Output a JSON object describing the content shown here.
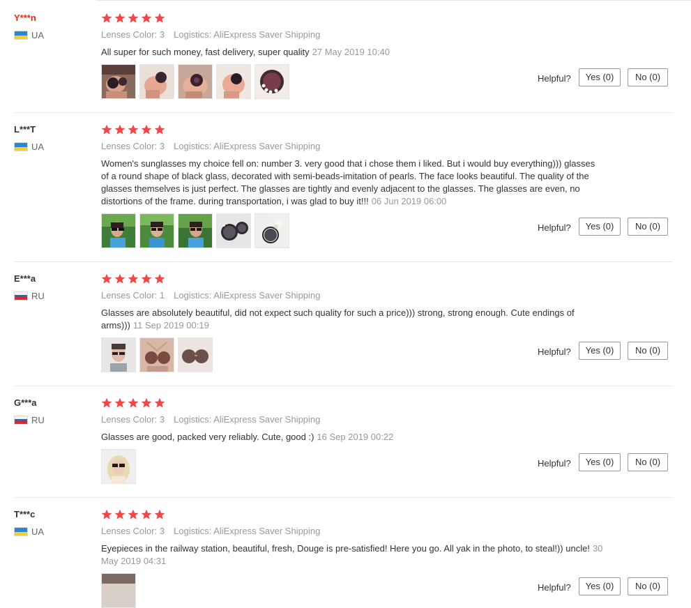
{
  "helpful_label": "Helpful?",
  "star_color": "#f04848",
  "reviews": [
    {
      "name": "Y***n",
      "name_highlight": true,
      "country": "UA",
      "flag": "ua",
      "stars": 5,
      "lenses_label": "Lenses Color:",
      "lenses_value": "3",
      "logistics_label": "Logistics:",
      "logistics_value": "AliExpress Saver Shipping",
      "text": "All super for such money, fast delivery, super quality",
      "date": "27 May 2019 10:40",
      "photos": 5,
      "yes": "Yes (0)",
      "no": "No (0)"
    },
    {
      "name": "L***T",
      "name_highlight": false,
      "country": "UA",
      "flag": "ua",
      "stars": 5,
      "lenses_label": "Lenses Color:",
      "lenses_value": "3",
      "logistics_label": "Logistics:",
      "logistics_value": "AliExpress Saver Shipping",
      "text": "Women's sunglasses my choice fell on: number 3. very good that i chose them i liked. But i would buy everything))) glasses of a round shape of black glass, decorated with semi-beads-imitation of pearls. The face looks beautiful. The quality of the glasses themselves is just perfect. The glasses are tightly and evenly adjacent to the glasses. The glasses are even, no distortions of the frame. during transportation, i was glad to buy it!!!",
      "date": "06 Jun 2019 06:00",
      "photos": 5,
      "yes": "Yes (0)",
      "no": "No (0)"
    },
    {
      "name": "E***a",
      "name_highlight": false,
      "country": "RU",
      "flag": "ru",
      "stars": 5,
      "lenses_label": "Lenses Color:",
      "lenses_value": "1",
      "logistics_label": "Logistics:",
      "logistics_value": "AliExpress Saver Shipping",
      "text": "Glasses are absolutely beautiful, did not expect such quality for such a price))) strong, strong enough. Cute endings of arms)))",
      "date": "11 Sep 2019 00:19",
      "photos": 3,
      "yes": "Yes (0)",
      "no": "No (0)"
    },
    {
      "name": "G***a",
      "name_highlight": false,
      "country": "RU",
      "flag": "ru",
      "stars": 5,
      "lenses_label": "Lenses Color:",
      "lenses_value": "3",
      "logistics_label": "Logistics:",
      "logistics_value": "AliExpress Saver Shipping",
      "text": "Glasses are good, packed very reliably. Cute, good :)",
      "date": "16 Sep 2019 00:22",
      "photos": 1,
      "yes": "Yes (0)",
      "no": "No (0)"
    },
    {
      "name": "T***c",
      "name_highlight": false,
      "country": "UA",
      "flag": "ua",
      "stars": 5,
      "lenses_label": "Lenses Color:",
      "lenses_value": "3",
      "logistics_label": "Logistics:",
      "logistics_value": "AliExpress Saver Shipping",
      "text": "Eyepieces in the railway station, beautiful, fresh, Douge is pre-satisfied! Here you go. All yak in the photo, to steal!)) uncle!",
      "date": "30 May 2019 04:31",
      "photos": 1,
      "yes": "Yes (0)",
      "no": "No (0)"
    }
  ]
}
